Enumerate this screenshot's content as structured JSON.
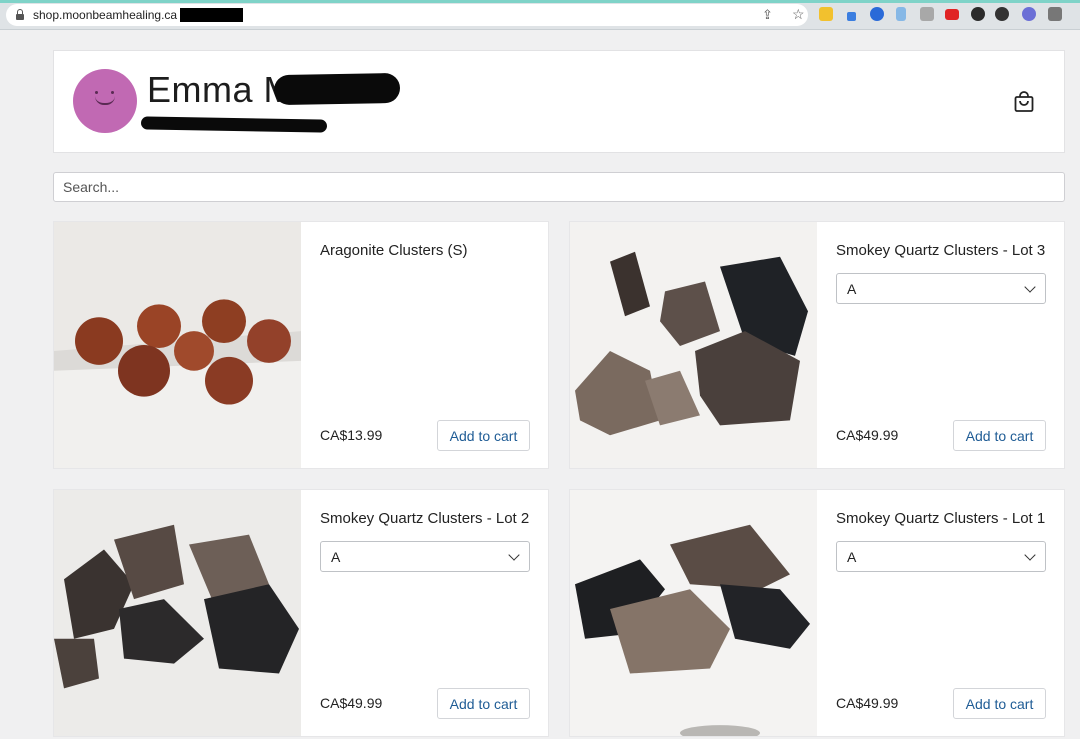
{
  "browser": {
    "url": "shop.moonbeamhealing.ca",
    "extensions": [
      "notes-icon",
      "pen-tool-icon",
      "circle-play-icon",
      "flag-icon",
      "code-icon",
      "youtube-icon",
      "circle-icon",
      "k-icon",
      "puzzle-badge-icon",
      "puzzle-icon"
    ]
  },
  "store": {
    "name": "Emma M",
    "avatar_color": "#c169b3",
    "cart_icon": "shopping-bag-icon"
  },
  "search": {
    "placeholder": "Search..."
  },
  "products": [
    {
      "title": "Aragonite Clusters (S)",
      "price": "CA$13.99",
      "button": "Add to cart",
      "has_select": false,
      "select_value": ""
    },
    {
      "title": "Smokey Quartz Clusters - Lot 3",
      "price": "CA$49.99",
      "button": "Add to cart",
      "has_select": true,
      "select_value": "A"
    },
    {
      "title": "Smokey Quartz Clusters - Lot 2",
      "price": "CA$49.99",
      "button": "Add to cart",
      "has_select": true,
      "select_value": "A"
    },
    {
      "title": "Smokey Quartz Clusters - Lot 1",
      "price": "CA$49.99",
      "button": "Add to cart",
      "has_select": true,
      "select_value": "A"
    }
  ],
  "colors": {
    "accent": "#1f5c95",
    "background": "#f0f0f1"
  }
}
